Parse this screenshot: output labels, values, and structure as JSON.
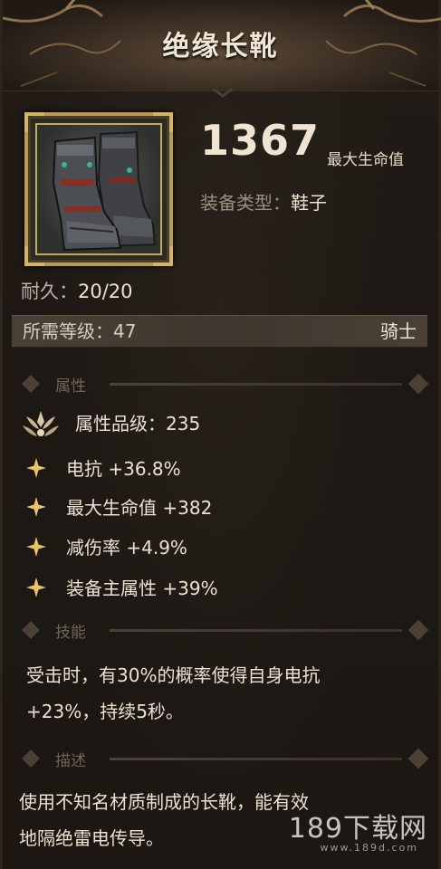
{
  "item": {
    "name": "绝缘长靴",
    "main_stat_value": "1367",
    "main_stat_label": "最大生命值",
    "equip_type_label": "装备类型：",
    "equip_type_value": "鞋子",
    "durability_label": "耐久：",
    "durability_value": "20/20",
    "required_level": "所需等级：47",
    "class": "骑士"
  },
  "sections": {
    "attributes": "属性",
    "skill": "技能",
    "description": "描述"
  },
  "attributes": {
    "grade": "属性品级：235",
    "rows": [
      "电抗 +36.8%",
      "最大生命值 +382",
      "减伤率 +4.9%",
      "装备主属性 +39%"
    ]
  },
  "skill": {
    "line1": "受击时，有30%的概率使得自身电抗",
    "line2": "+23%，持续5秒。"
  },
  "description": {
    "line1": "使用不知名材质制成的长靴，能有效",
    "line2": "地隔绝雷电传导。"
  },
  "watermark": {
    "main": "189下载网",
    "sub": "www.189d.com"
  },
  "icons": {
    "boots": "boots-icon",
    "grade": "attribute-grade-icon",
    "star": "sparkle-star-icon"
  },
  "colors": {
    "gold": "#d4b567",
    "text": "#ece2d2",
    "muted": "#6f6558"
  }
}
